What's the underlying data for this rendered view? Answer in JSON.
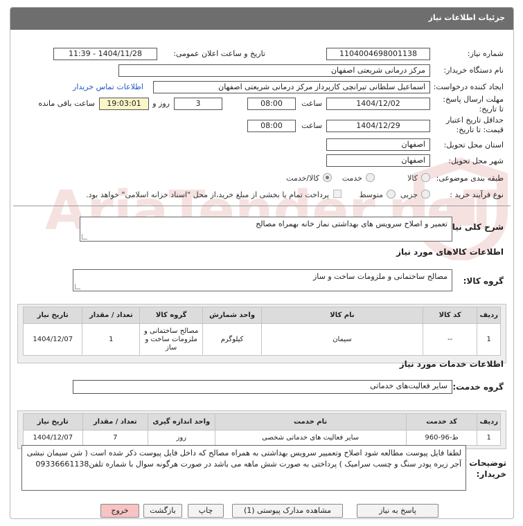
{
  "header": {
    "title": "جزئیات اطلاعات نیاز"
  },
  "fields": {
    "need_number": {
      "label": "شماره نیاز:",
      "value": "1104004698001138"
    },
    "announce": {
      "label": "تاریخ و ساعت اعلان عمومی:",
      "value": "1404/11/28 - 11:39"
    },
    "buyer_org": {
      "label": "نام دستگاه خریدار:",
      "value": "مرکز درمانی شریعتی اصفهان"
    },
    "requester": {
      "label": "ایجاد کننده درخواست:",
      "value": "اسماعیل سلطانی تیرانچی کارپرداز مرکز درمانی شریعتی اصفهان",
      "contact_link": "اطلاعات تماس خریدار"
    },
    "deadline": {
      "label": "مهلت ارسال پاسخ: تا تاریخ:",
      "date": "1404/12/02",
      "time_label": "ساعت",
      "time": "08:00",
      "days": "3",
      "days_label": "روز و",
      "remaining": "19:03:01",
      "remaining_label": "ساعت باقی مانده"
    },
    "validity": {
      "label": "حداقل تاریخ اعتبار قیمت: تا تاریخ:",
      "date": "1404/12/29",
      "time_label": "ساعت",
      "time": "08:00"
    },
    "province": {
      "label": "استان محل تحویل:",
      "value": "اصفهان"
    },
    "city": {
      "label": "شهر محل تحویل:",
      "value": "اصفهان"
    },
    "category": {
      "label": "طبقه بندی موضوعی:",
      "options": [
        "کالا",
        "خدمت",
        "کالا/خدمت"
      ],
      "selected": "کالا/خدمت"
    },
    "process": {
      "label": "نوع فرآیند خرید :",
      "options": [
        "جزیی",
        "متوسط"
      ],
      "note": "پرداخت تمام یا بخشی از مبلغ خرید،از محل \"اسناد خزانه اسلامی\" خواهد بود."
    }
  },
  "summary": {
    "label": "شرح کلی نیاز:",
    "value": "تعمیر و اصلاح سرویس های بهداشتی نماز خانه  بهمراه مصالح"
  },
  "goods": {
    "section_title": "اطلاعات کالاهای مورد نیاز",
    "group_label": "گروه کالا:",
    "group_value": "مصالح ساختمانی و ملزومات ساخت و ساز",
    "columns": [
      "ردیف",
      "کد کالا",
      "نام کالا",
      "واحد شمارش",
      "گروه کالا",
      "تعداد / مقدار",
      "تاریخ نیاز"
    ],
    "rows": [
      {
        "idx": "1",
        "code": "--",
        "name": "سیمان",
        "unit": "کیلوگرم",
        "group": "مصالح ساختمانی و ملزومات ساخت و ساز",
        "qty": "1",
        "date": "1404/12/07"
      }
    ]
  },
  "services": {
    "section_title": "اطلاعات خدمات مورد نیاز",
    "group_label": "گروه خدمت:",
    "group_value": "سایر فعالیت‌های خدماتی",
    "columns": [
      "ردیف",
      "کد خدمت",
      "نام خدمت",
      "واحد اندازه گیری",
      "تعداد / مقدار",
      "تاریخ نیاز"
    ],
    "rows": [
      {
        "idx": "1",
        "code": "ط-96-960",
        "name": "سایر فعالیت های خدماتی شخصی",
        "unit": "روز",
        "qty": "7",
        "date": "1404/12/07"
      }
    ]
  },
  "buyer_notes": {
    "label": "توضیحات خریدار:",
    "value": "لطفا فایل پیوست مطالعه شود اصلاح وتعمییر سرویس بهداشتی  به همراه مصالح که داخل فایل پیوست ذکر شده است ( شن سیمان نبشی آجر زیره پودر سنگ و چسب سرامیک ) پرداختی به صورت شش ماهه می باشد در صورت هرگونه سوال با شماره تلفن09336661138"
  },
  "buttons": {
    "reply": "پاسخ به نیاز",
    "attachments": "مشاهده مدارک پیوستی (1)",
    "print": "چاپ",
    "back": "بازگشت",
    "exit": "خروج"
  },
  "watermark": {
    "text": "AriaTender.neT"
  },
  "colors": {
    "titlebar": "#6e6e6e",
    "link": "#1d56c8",
    "highlight": "#fbf6c8",
    "exit_button": "#f7c3c3",
    "watermark": "#c0392b"
  }
}
